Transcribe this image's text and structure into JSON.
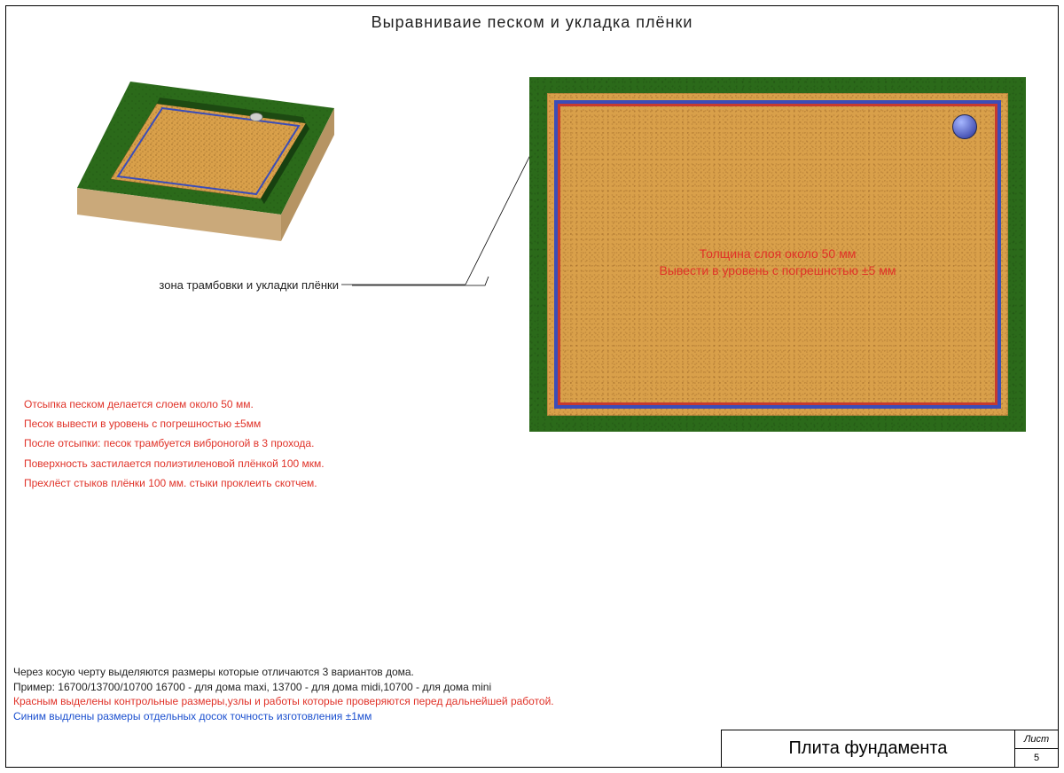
{
  "title": "Выравниваие  песком и укладка плёнки",
  "leader_label": "зона трамбовки и укладки плёнки",
  "plan_notes": {
    "line1": "Толщина слоя около 50 мм",
    "line2": "Вывести в уровень с погрешнстью  ±5 мм"
  },
  "red_instructions": [
    "Отсыпка песком делается слоем около 50 мм.",
    "Песок вывести в уровень с погрешностью  ±5мм",
    "После отсыпки: песок трамбуется виброногой в 3 прохода.",
    "Поверхность застилается полиэтиленовой плёнкой 100 мкм.",
    "Прехлёст стыков плёнки 100 мм. стыки проклеить скотчем."
  ],
  "bottom_notes": {
    "l1": "Через косую черту  выделяются размеры которые отличаются  3 вариантов дома.",
    "l2": "Пример: 16700/13700/10700  16700 - для дома maxi, 13700 - для дома midi,10700 - для дома mini",
    "l3": "Красным выделены контрольные размеры,узлы и работы которые проверяются перед дальнейшей работой.",
    "l4": "Синим выдлены размеры отдельных досок точность изготовления ±1мм"
  },
  "titleblock": {
    "main": "Плита фундамента",
    "sheet_label": "Лист",
    "sheet_no": "5"
  },
  "colors": {
    "grass": "#2b6a1a",
    "sand": "#d9a04a",
    "film_blue": "#3b4db8",
    "film_red": "#c63a2f",
    "note_red": "#e03228",
    "note_blue": "#1a4fcf"
  }
}
